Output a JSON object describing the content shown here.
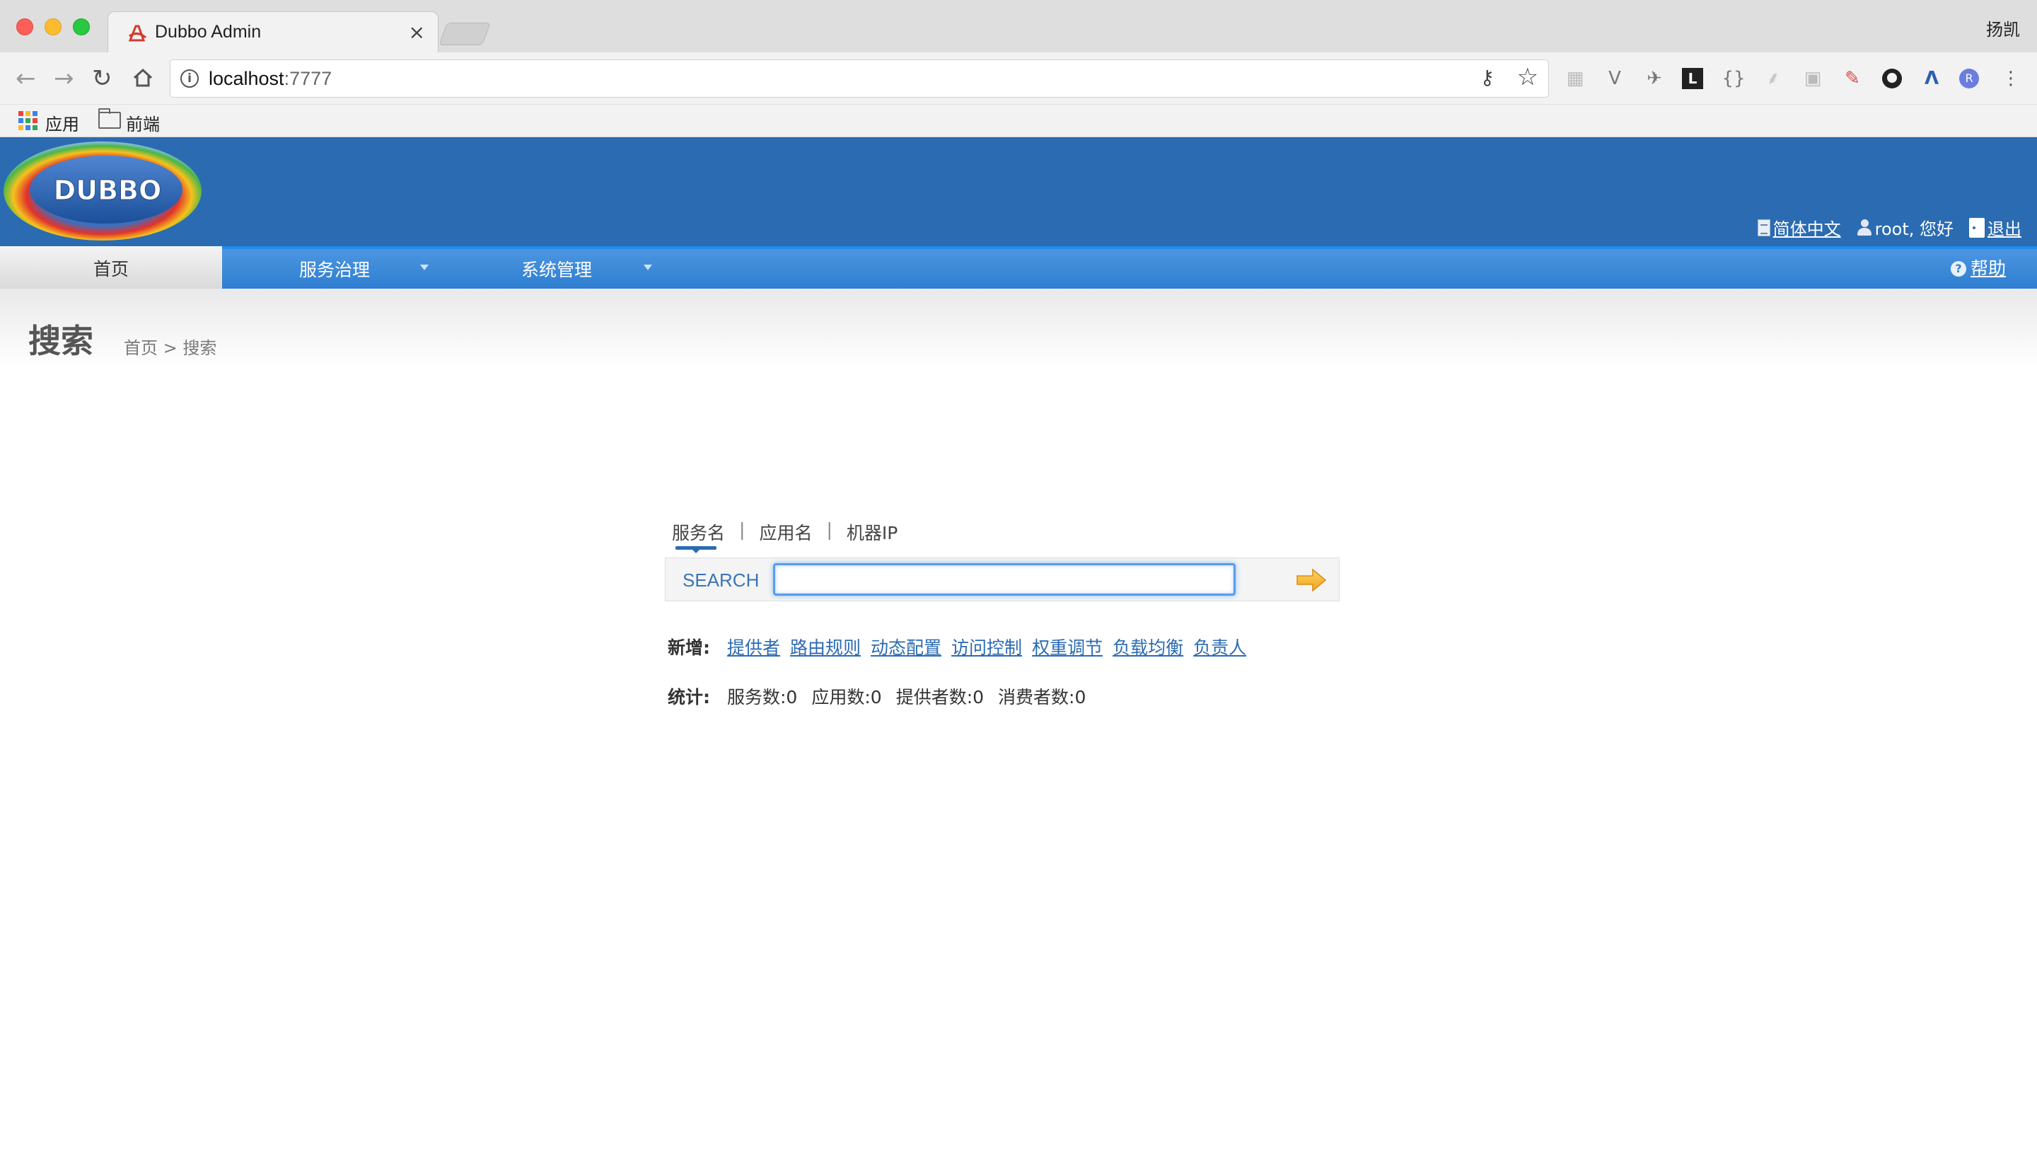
{
  "browser": {
    "tab_title": "Dubbo Admin",
    "tab_close": "×",
    "profile_name": "扬凯",
    "url_host": "localhost",
    "url_port": ":7777",
    "bookmarks": {
      "apps": "应用",
      "folder": "前端"
    }
  },
  "header": {
    "logo_text": "DUBBO",
    "language": "简体中文",
    "greeting": "root, 您好",
    "logout": "退出"
  },
  "nav": {
    "home": "首页",
    "service_governance": "服务治理",
    "system_management": "系统管理",
    "help": "帮助"
  },
  "page": {
    "title": "搜索",
    "breadcrumb": "首页 > 搜索"
  },
  "search": {
    "tabs": [
      "服务名",
      "应用名",
      "机器IP"
    ],
    "active_tab": "服务名",
    "label": "SEARCH",
    "input_value": ""
  },
  "quick_add": {
    "label": "新增:",
    "links": [
      "提供者",
      "路由规则",
      "动态配置",
      "访问控制",
      "权重调节",
      "负载均衡",
      "负责人"
    ]
  },
  "stats": {
    "label": "统计:",
    "items": [
      "服务数:0",
      "应用数:0",
      "提供者数:0",
      "消费者数:0"
    ]
  },
  "colors": {
    "header_blue": "#2b6bb2",
    "nav_blue": "#3d8ad9",
    "link_blue": "#2b6bb2"
  }
}
